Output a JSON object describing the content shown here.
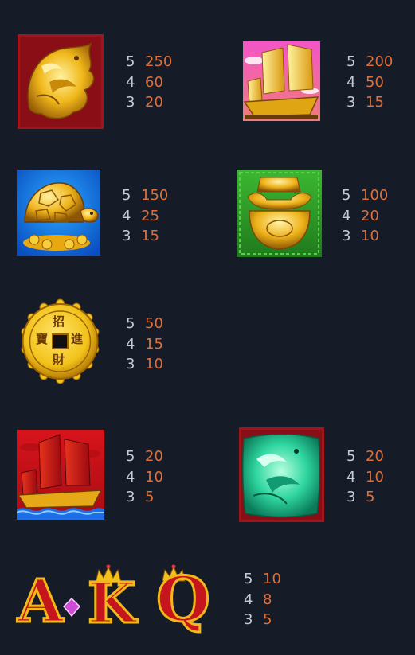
{
  "paytable": [
    {
      "symbol": "golden-phoenix",
      "pays": [
        {
          "count": "5",
          "value": "250"
        },
        {
          "count": "4",
          "value": "60"
        },
        {
          "count": "3",
          "value": "20"
        }
      ]
    },
    {
      "symbol": "golden-junk-ship",
      "pays": [
        {
          "count": "5",
          "value": "200"
        },
        {
          "count": "4",
          "value": "50"
        },
        {
          "count": "3",
          "value": "15"
        }
      ]
    },
    {
      "symbol": "golden-turtle",
      "pays": [
        {
          "count": "5",
          "value": "150"
        },
        {
          "count": "4",
          "value": "25"
        },
        {
          "count": "3",
          "value": "15"
        }
      ]
    },
    {
      "symbol": "gold-ingot",
      "pays": [
        {
          "count": "5",
          "value": "100"
        },
        {
          "count": "4",
          "value": "20"
        },
        {
          "count": "3",
          "value": "10"
        }
      ]
    },
    {
      "symbol": "gold-coin",
      "pays": [
        {
          "count": "5",
          "value": "50"
        },
        {
          "count": "4",
          "value": "15"
        },
        {
          "count": "3",
          "value": "10"
        }
      ]
    },
    {
      "symbol": "red-junk-ship",
      "pays": [
        {
          "count": "5",
          "value": "20"
        },
        {
          "count": "4",
          "value": "10"
        },
        {
          "count": "3",
          "value": "5"
        }
      ]
    },
    {
      "symbol": "jade-phoenix",
      "pays": [
        {
          "count": "5",
          "value": "20"
        },
        {
          "count": "4",
          "value": "10"
        },
        {
          "count": "3",
          "value": "5"
        }
      ]
    },
    {
      "symbol": "aces-kings-queens",
      "pays": [
        {
          "count": "5",
          "value": "10"
        },
        {
          "count": "4",
          "value": "8"
        },
        {
          "count": "3",
          "value": "5"
        }
      ]
    }
  ],
  "coin_characters": [
    "招",
    "進",
    "財",
    "寶"
  ],
  "card_letters": [
    "A",
    "K",
    "Q"
  ],
  "colors": {
    "background": "#161b28",
    "count_text": "#c5cad8",
    "value_text": "#e0703a",
    "gold": "#f2c21a",
    "red": "#b3121c",
    "jade": "#2fd6a0"
  }
}
